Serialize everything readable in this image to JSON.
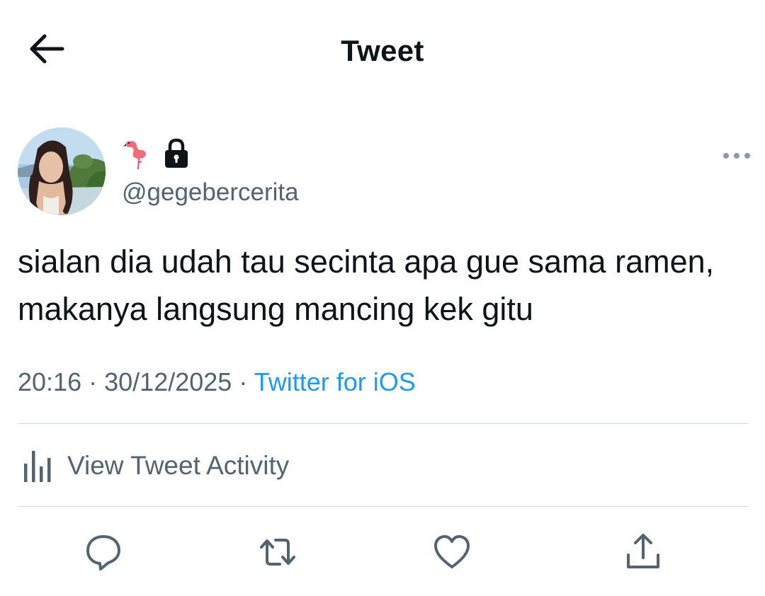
{
  "header": {
    "title": "Tweet",
    "back_icon": "arrow-left-icon"
  },
  "author": {
    "display_name_icons": [
      "flamingo-emoji",
      "lock-icon"
    ],
    "handle": "@gegebercerita",
    "avatar": "profile-photo"
  },
  "tweet": {
    "text": "sialan dia udah tau secinta apa gue sama ramen, makanya langsung mancing kek gitu",
    "time": "20:16",
    "separator": "·",
    "date": "30/12/2025",
    "source": "Twitter for iOS"
  },
  "activity": {
    "label": "View Tweet Activity",
    "icon": "bar-chart-icon"
  },
  "actions": [
    "reply-icon",
    "retweet-icon",
    "like-icon",
    "share-icon"
  ],
  "colors": {
    "text": "#0f1419",
    "secondary": "#536471",
    "link": "#1d9bf0",
    "divider": "#cfd9de"
  }
}
